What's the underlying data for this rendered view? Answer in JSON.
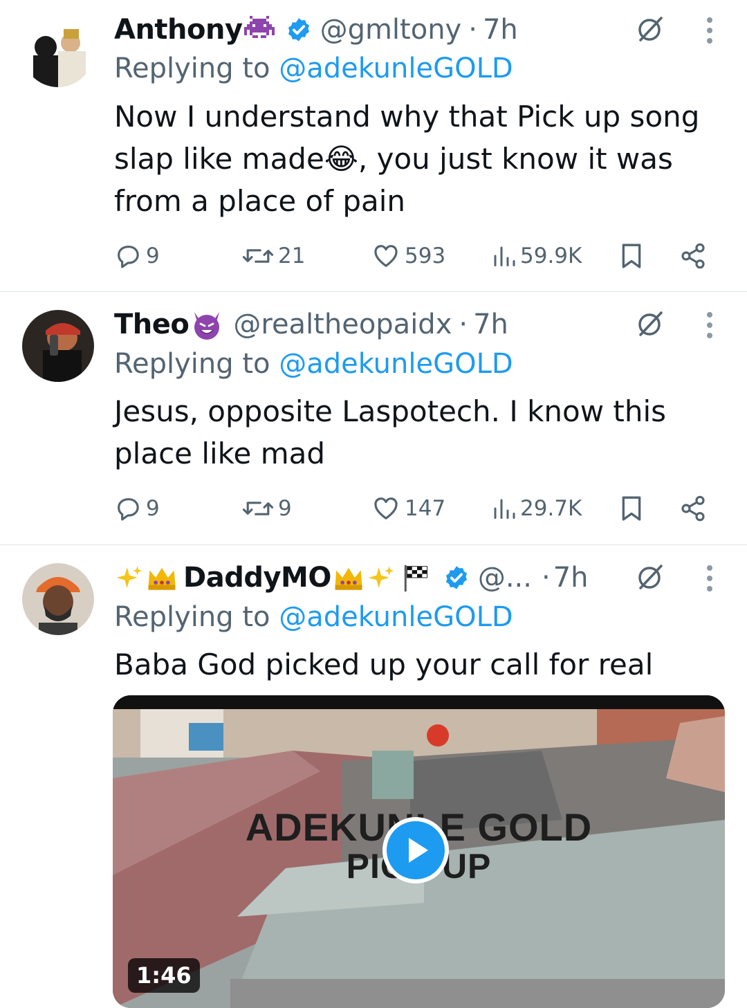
{
  "colors": {
    "text": "#0f1419",
    "secondary": "#536471",
    "link": "#1d9bf0",
    "verified": "#1d9bf0",
    "divider": "#e1e5e8"
  },
  "tweets": [
    {
      "name": "Anthony",
      "name_emoji": "alien-monster-emoji",
      "verified": true,
      "handle": "@gmltony",
      "time": "7h",
      "replying_prefix": "Replying to",
      "replying_to": "@adekunleGOLD",
      "text_before_emoji": "Now I understand why that Pick up song slap like made",
      "text_emoji": "😂",
      "text_after_emoji": ", you just know it was from a place of pain",
      "replies": "9",
      "retweets": "21",
      "likes": "593",
      "views": "59.9K"
    },
    {
      "name": "Theo",
      "name_emoji": "smiling-devil-emoji",
      "verified": false,
      "handle": "@realtheopaidx",
      "time": "7h",
      "replying_prefix": "Replying to",
      "replying_to": "@adekunleGOLD",
      "text": "Jesus, opposite Laspotech. I know this place like mad",
      "replies": "9",
      "retweets": "9",
      "likes": "147",
      "views": "29.7K"
    },
    {
      "name": "DaddyMO",
      "name_emojis": [
        "sparkles-emoji",
        "crown-emoji",
        "crown-emoji",
        "sparkles-emoji",
        "chequered-flag-emoji"
      ],
      "verified": true,
      "handle": "@...",
      "time": "7h",
      "replying_prefix": "Replying to",
      "replying_to": "@adekunleGOLD",
      "text": "Baba God picked up your call for real",
      "media": {
        "title_line1": "ADEKUNLE GOLD",
        "title_line2": "PICK UP",
        "duration": "1:46"
      }
    }
  ],
  "icons": {
    "reply": "reply-bubble-icon",
    "retweet": "retweet-icon",
    "like": "heart-icon",
    "views": "views-bar-icon",
    "bookmark": "bookmark-icon",
    "share": "share-icon",
    "grok": "grok-slash-icon",
    "more": "more-vertical-icon",
    "verified": "verified-badge-icon",
    "play": "play-icon"
  }
}
